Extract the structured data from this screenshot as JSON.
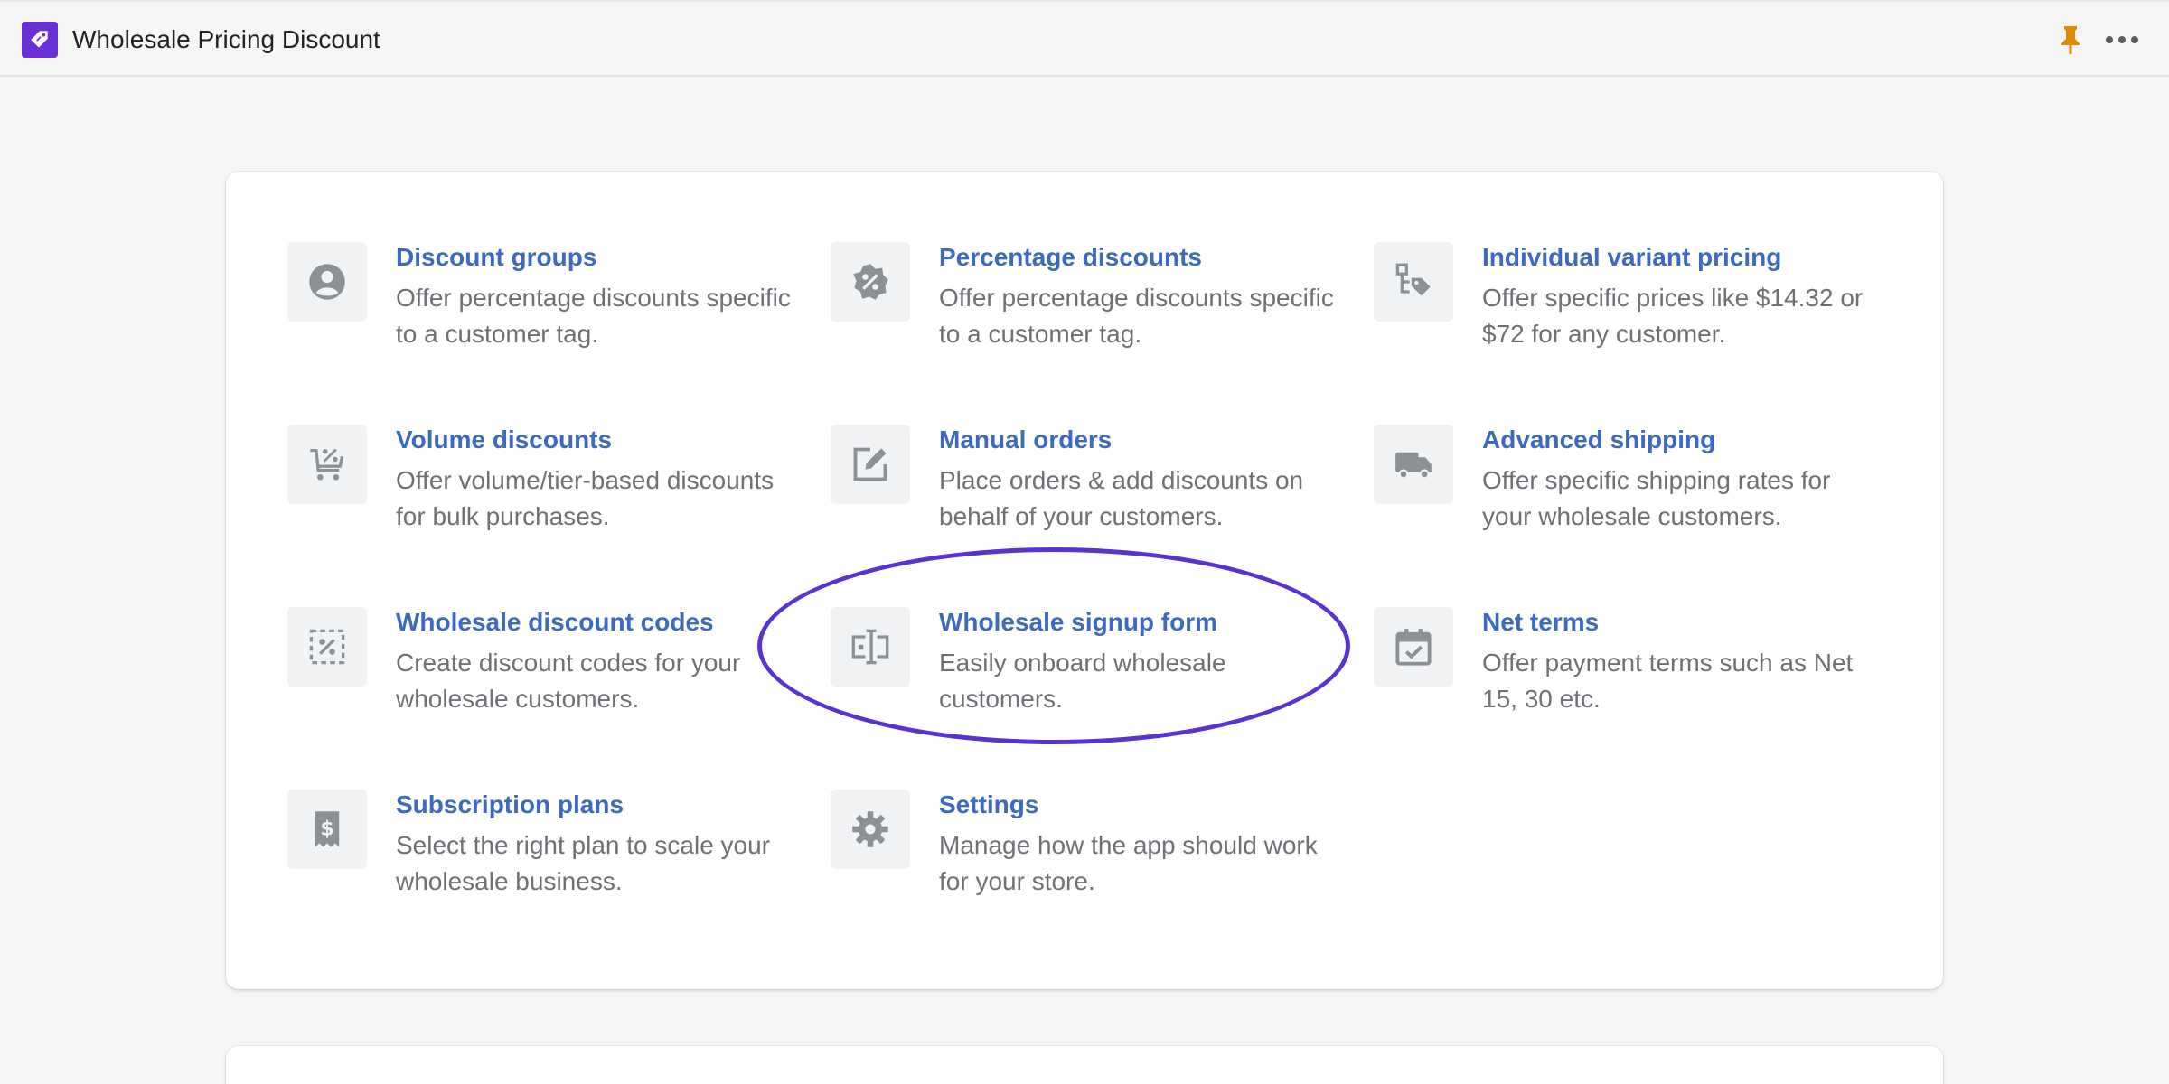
{
  "header": {
    "title": "Wholesale Pricing Discount",
    "logo_icon": "price-tag-icon",
    "pin_icon": "pin-icon",
    "more_icon": "more-horizontal-icon"
  },
  "colors": {
    "link": "#3b6ac0",
    "text_muted": "#6d7175",
    "brand": "#6a2fd6",
    "pin": "#e08a00",
    "highlight": "#5a32d2"
  },
  "features": [
    {
      "title": "Discount groups",
      "desc": "Offer percentage discounts specific to a customer tag.",
      "icon": "customer-icon"
    },
    {
      "title": "Percentage discounts",
      "desc": "Offer percentage discounts specific to a customer tag.",
      "icon": "discount-badge-icon"
    },
    {
      "title": "Individual variant pricing",
      "desc": "Offer specific prices like $14.32 or $72 for any customer.",
      "icon": "variant-tag-icon"
    },
    {
      "title": "Volume discounts",
      "desc": "Offer volume/tier-based discounts for bulk purchases.",
      "icon": "cart-discount-icon"
    },
    {
      "title": "Manual orders",
      "desc": "Place orders & add discounts on behalf of your customers.",
      "icon": "compose-icon"
    },
    {
      "title": "Advanced shipping",
      "desc": "Offer specific shipping rates for your wholesale customers.",
      "icon": "truck-icon"
    },
    {
      "title": "Wholesale discount codes",
      "desc": "Create discount codes for your wholesale customers.",
      "icon": "discount-code-icon"
    },
    {
      "title": "Wholesale signup form",
      "desc": "Easily onboard wholesale customers.",
      "icon": "form-field-icon"
    },
    {
      "title": "Net terms",
      "desc": "Offer payment terms such as Net 15, 30 etc.",
      "icon": "calendar-check-icon"
    },
    {
      "title": "Subscription plans",
      "desc": "Select the right plan to scale your wholesale business.",
      "icon": "receipt-dollar-icon"
    },
    {
      "title": "Settings",
      "desc": "Manage how the app should work for your store.",
      "icon": "gear-icon"
    }
  ],
  "highlighted_feature": "Wholesale signup form"
}
